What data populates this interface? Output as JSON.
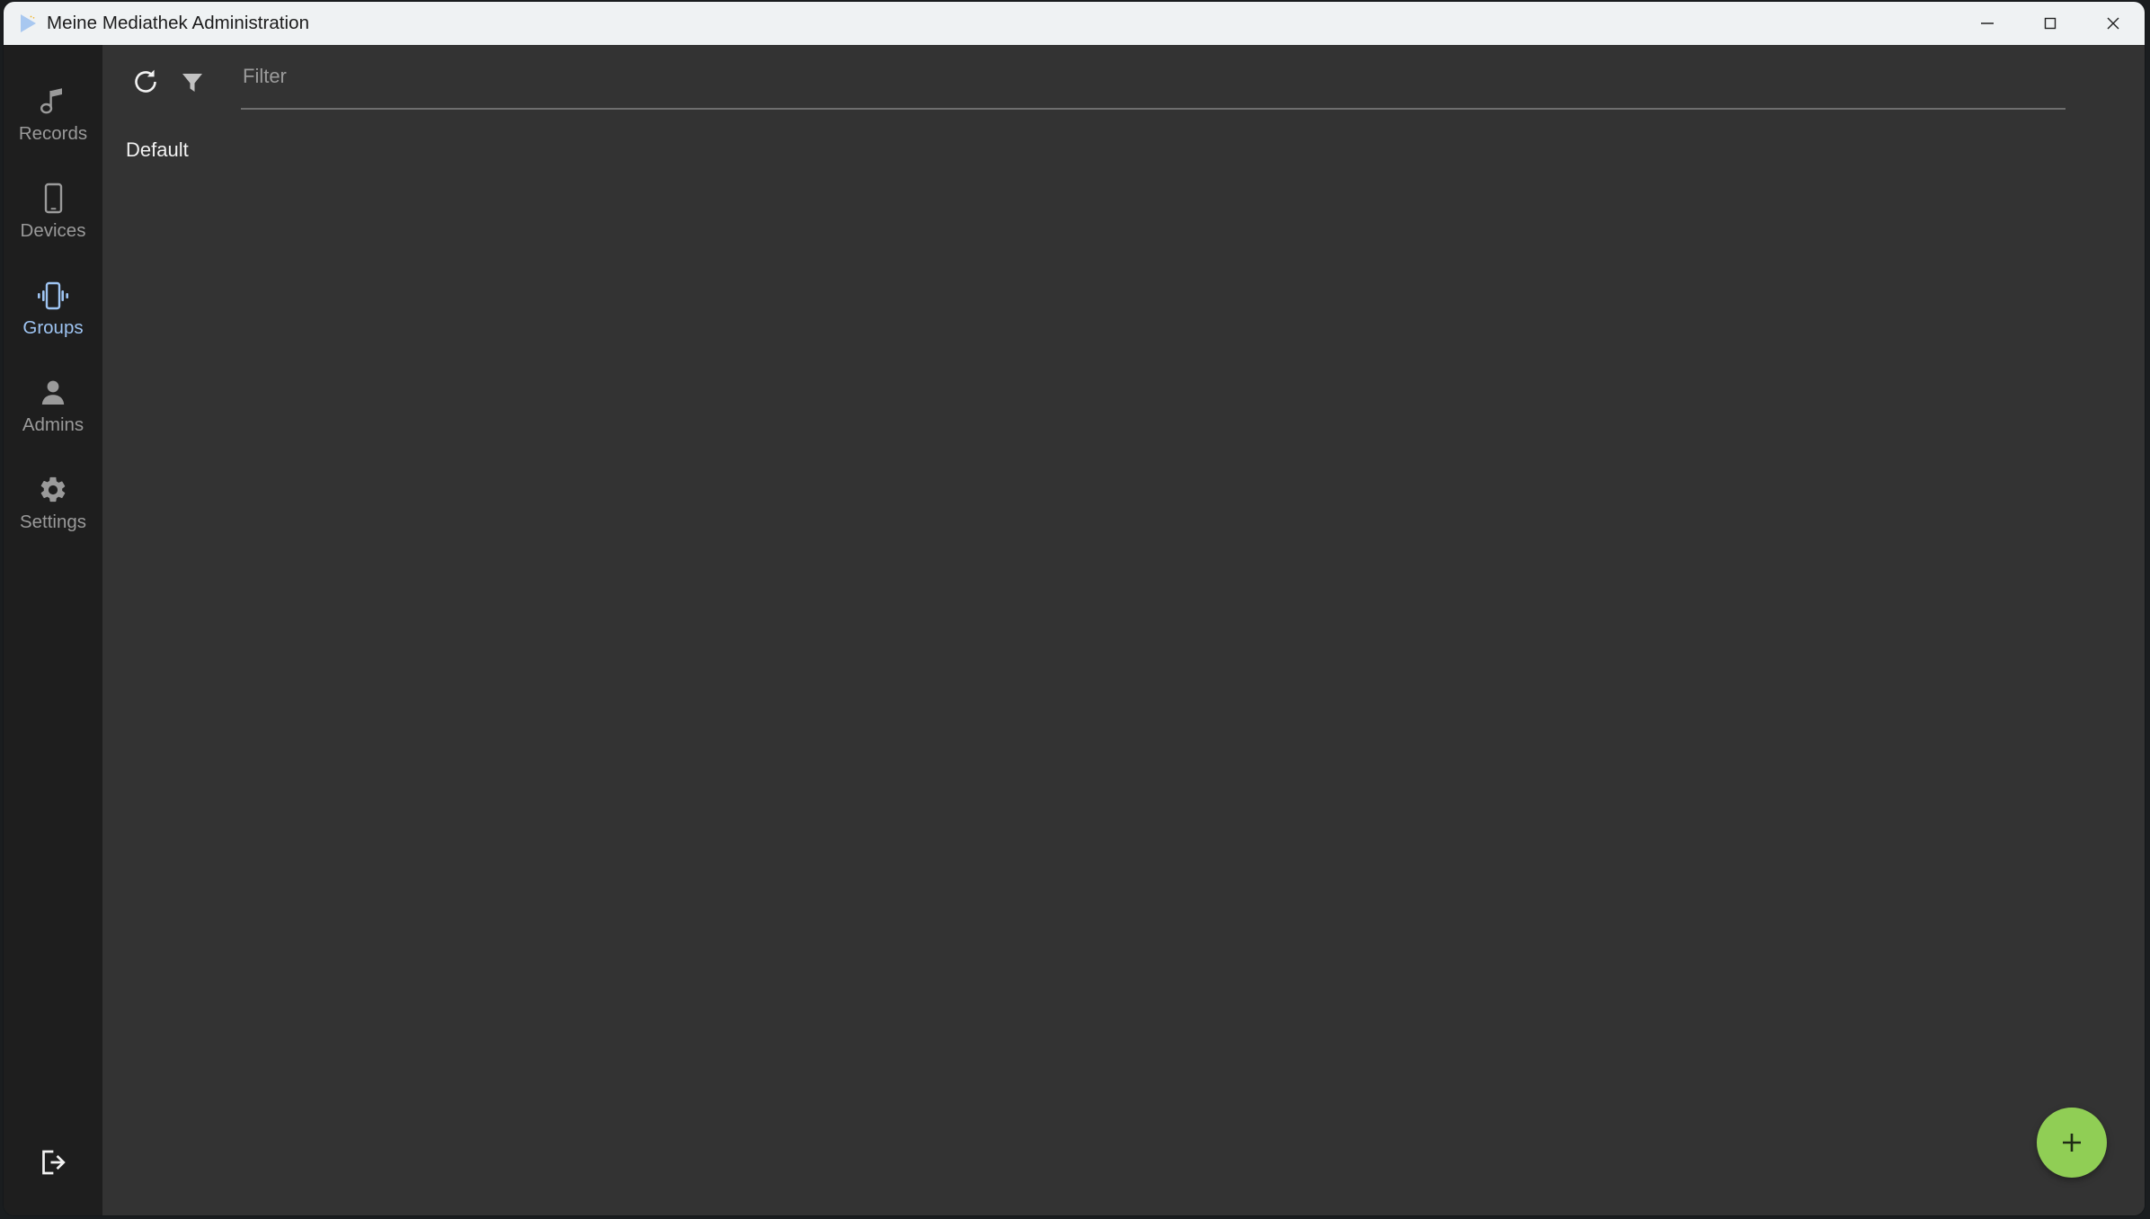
{
  "window": {
    "title": "Meine Mediathek Administration",
    "logo_icon": "play-triangle-icon",
    "controls": {
      "minimize_label": "Minimize",
      "minimize_icon": "minimize-icon",
      "maximize_label": "Maximize",
      "maximize_icon": "maximize-icon",
      "close_label": "Close",
      "close_icon": "close-icon"
    }
  },
  "sidebar": {
    "items": [
      {
        "label": "Records",
        "icon": "music-note-icon",
        "active": false
      },
      {
        "label": "Devices",
        "icon": "smartphone-icon",
        "active": false
      },
      {
        "label": "Groups",
        "icon": "vibrating-phone-icon",
        "active": true
      },
      {
        "label": "Admins",
        "icon": "person-icon",
        "active": false
      },
      {
        "label": "Settings",
        "icon": "gear-icon",
        "active": false
      }
    ],
    "logout": {
      "label": "Logout",
      "icon": "logout-icon"
    },
    "active_color": "#9ec4f2",
    "inactive_color": "#9a9a9a",
    "background": "#1e1e1e"
  },
  "toolbar": {
    "refresh": {
      "label": "Refresh",
      "icon": "refresh-icon"
    },
    "filter_toggle": {
      "label": "Filter",
      "icon": "funnel-icon"
    },
    "filter_input": {
      "placeholder": "Filter",
      "value": ""
    }
  },
  "main": {
    "list_items": [
      {
        "name": "Default"
      }
    ]
  },
  "fab": {
    "label": "Add",
    "icon": "plus-icon",
    "color": "#90ce55",
    "glyph_color": "#1f2b15"
  },
  "colors": {
    "title_bar": "#eff2f3",
    "content_background": "#333333",
    "sidebar_background": "#1e1e1e",
    "accent": "#9ec4f2",
    "add_green": "#90ce55"
  }
}
